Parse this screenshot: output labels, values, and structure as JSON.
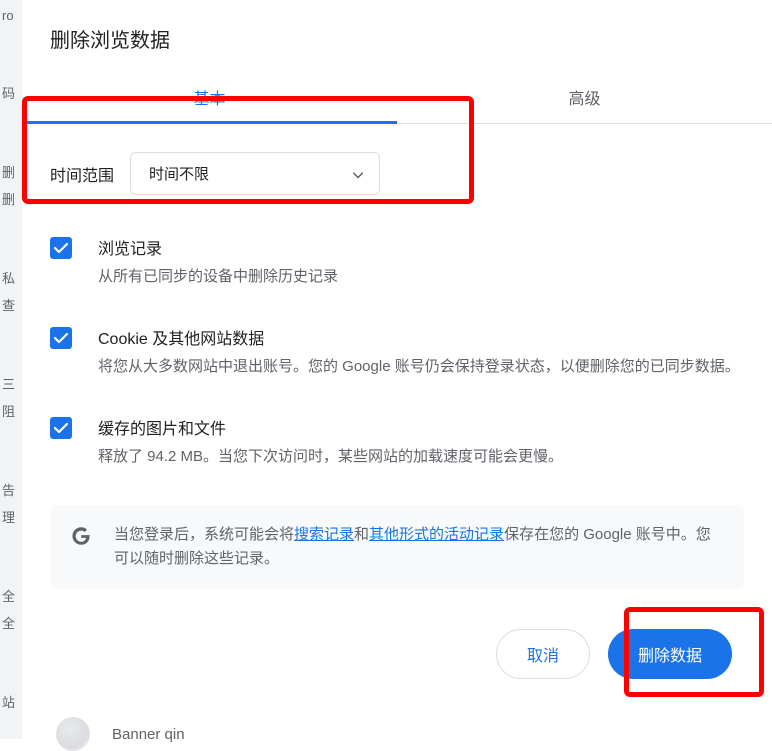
{
  "dialog": {
    "title": "删除浏览数据"
  },
  "tabs": {
    "basic": "基本",
    "advanced": "高级"
  },
  "time_range": {
    "label": "时间范围",
    "selected": "时间不限"
  },
  "options": {
    "browsing": {
      "title": "浏览记录",
      "desc": "从所有已同步的设备中删除历史记录",
      "checked": true
    },
    "cookies": {
      "title": "Cookie 及其他网站数据",
      "desc": "将您从大多数网站中退出账号。您的 Google 账号仍会保持登录状态，以便删除您的已同步数据。",
      "checked": true
    },
    "cache": {
      "title": "缓存的图片和文件",
      "desc_pre": "释放了 ",
      "desc_size": "94.2 MB",
      "desc_post": "。当您下次访问时，某些网站的加载速度可能会更慢。",
      "checked": true
    }
  },
  "info": {
    "pre": "当您登录后，系统可能会将",
    "link1": "搜索记录",
    "mid": "和",
    "link2": "其他形式的活动记录",
    "post": "保存在您的 Google 账号中。您可以随时删除这些记录。"
  },
  "footer": {
    "cancel": "取消",
    "confirm": "删除数据"
  },
  "user": {
    "name": "Banner qin"
  },
  "bg": {
    "l1": "ro",
    "l2": "码",
    "l3": "删",
    "l4": "删",
    "l5": "私",
    "l6": "查",
    "l7": "三",
    "l8": "阻",
    "l9": "告",
    "l10": "理",
    "l11": "全",
    "l12": "全",
    "l13": "站"
  }
}
